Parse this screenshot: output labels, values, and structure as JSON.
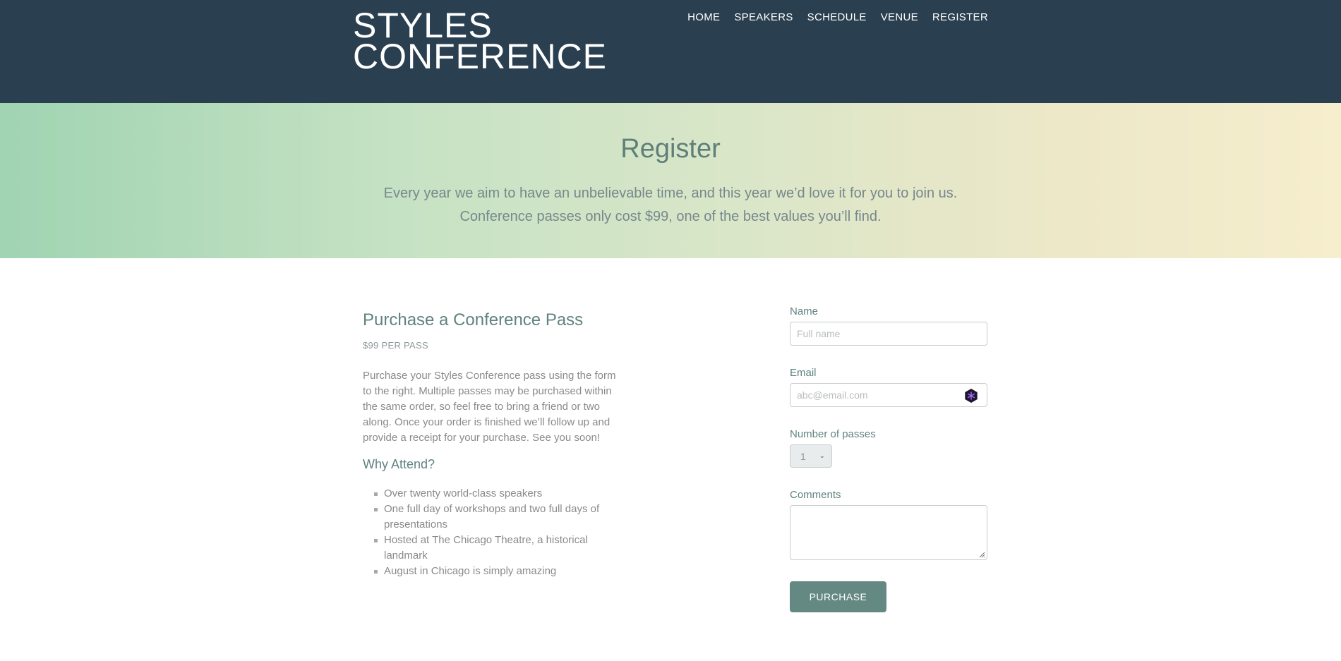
{
  "header": {
    "logo_line1": "STYLES",
    "logo_line2": "CONFERENCE",
    "nav": [
      "HOME",
      "SPEAKERS",
      "SCHEDULE",
      "VENUE",
      "REGISTER"
    ]
  },
  "hero": {
    "title": "Register",
    "subtitle_line1": "Every year we aim to have an unbelievable time, and this year we’d love it for you to join us.",
    "subtitle_line2": "Conference passes only cost $99, one of the best values you’ll find."
  },
  "left": {
    "title": "Purchase a Conference Pass",
    "price": "$99 PER PASS",
    "body_lines": [
      "Purchase your Styles Conference pass using the form",
      "to the right. Multiple passes may be purchased within",
      "the same order, so feel free to bring a friend or two",
      "along. Once your order is finished we’ll follow up and",
      "provide a receipt for your purchase. See you soon!"
    ],
    "why_title": "Why Attend?",
    "why_items": [
      [
        "Over twenty world-class speakers"
      ],
      [
        "One full day of workshops and two full days of",
        "presentations"
      ],
      [
        "Hosted at The Chicago Theatre, a historical",
        "landmark"
      ],
      [
        "August in Chicago is simply amazing"
      ]
    ]
  },
  "form": {
    "name_label": "Name",
    "name_placeholder": "Full name",
    "email_label": "Email",
    "email_placeholder": "abc@email.com",
    "passes_label": "Number of passes",
    "passes_value": "1",
    "comments_label": "Comments",
    "submit_label": "PURCHASE"
  },
  "colors": {
    "header_bg": "#2a3f4f",
    "accent": "#648882",
    "hero_start": "#a0d4b2",
    "hero_end": "#f6eecd"
  }
}
